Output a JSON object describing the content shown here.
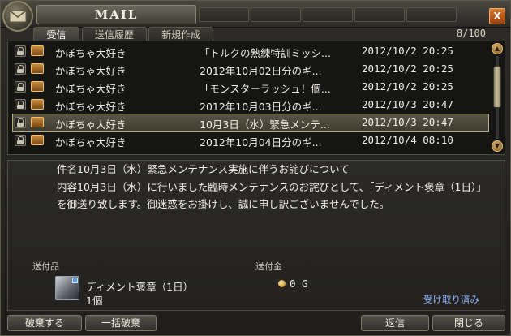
{
  "window": {
    "title": "MAIL",
    "close_label": "X"
  },
  "tabs": [
    {
      "label": "受信",
      "active": true
    },
    {
      "label": "送信履歴",
      "active": false
    },
    {
      "label": "新規作成",
      "active": false
    }
  ],
  "mail_count": "8/100",
  "mails": [
    {
      "sender": "かぼちゃ大好き",
      "subject": "「トルクの熟練特訓ミッシ...",
      "date": "2012/10/2 20:25",
      "selected": false
    },
    {
      "sender": "かぼちゃ大好き",
      "subject": "2012年10月02日分のギ...",
      "date": "2012/10/2 20:25",
      "selected": false
    },
    {
      "sender": "かぼちゃ大好き",
      "subject": "「モンスターラッシュ！個...",
      "date": "2012/10/2 20:25",
      "selected": false
    },
    {
      "sender": "かぼちゃ大好き",
      "subject": "2012年10月03日分のギ...",
      "date": "2012/10/3 20:47",
      "selected": false
    },
    {
      "sender": "かぼちゃ大好き",
      "subject": "10月3日（水）緊急メンテ...",
      "date": "2012/10/3 20:47",
      "selected": true
    },
    {
      "sender": "かぼちゃ大好き",
      "subject": "2012年10月04日分のギ...",
      "date": "2012/10/4 08:10",
      "selected": false
    }
  ],
  "detail": {
    "subject_label": "件名",
    "subject": "10月3日（水）緊急メンテナンス実施に伴うお詫びについて",
    "content_label": "内容",
    "content": "10月3日（水）に行いました臨時メンテナンスのお詫びとして、「ディメント褒章（1日）」を御送り致します。御迷惑をお掛けし、誠に申し訳ございませんでした。"
  },
  "attachment": {
    "label": "送付品",
    "item_name": "ディメント褒章（1日）",
    "quantity": "1個",
    "money_label": "送付金",
    "money": "0 G",
    "status": "受け取り済み"
  },
  "buttons": {
    "discard": "破棄する",
    "bulk_discard": "一括破棄",
    "reply": "返信",
    "close": "閉じる"
  },
  "colors": {
    "selected_row": "#5a5646",
    "received_text": "#8fb4ff",
    "close_button": "#d9782b"
  }
}
